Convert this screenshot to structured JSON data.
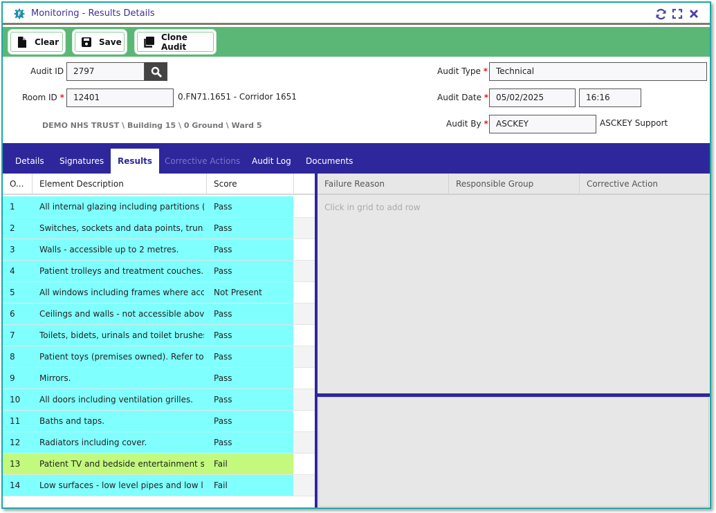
{
  "window": {
    "title": "Monitoring - Results Details",
    "app_icon": "gear-f-icon",
    "controls": [
      {
        "name": "refresh",
        "icon": "refresh-icon"
      },
      {
        "name": "maximize",
        "icon": "expand-icon"
      },
      {
        "name": "close",
        "icon": "close-icon"
      }
    ]
  },
  "toolbar": {
    "clear_label": "Clear",
    "save_label": "Save",
    "clone_label": "Clone Audit"
  },
  "form": {
    "audit_id": {
      "label": "Audit ID",
      "value": "2797"
    },
    "room_id": {
      "label": "Room ID",
      "required": "*",
      "value": "12401",
      "description": "0.FN71.1651 - Corridor 1651"
    },
    "location_path": "DEMO NHS TRUST \\ Building 15 \\ 0 Ground \\ Ward 5",
    "audit_type": {
      "label": "Audit Type",
      "required": "*",
      "value": "Technical"
    },
    "audit_date": {
      "label": "Audit Date",
      "required": "*",
      "date": "05/02/2025",
      "time": "16:16"
    },
    "audit_by": {
      "label": "Audit By",
      "required": "*",
      "value": "ASCKEY",
      "name": "ASCKEY Support"
    }
  },
  "tabs": [
    {
      "label": "Details",
      "state": "normal"
    },
    {
      "label": "Signatures",
      "state": "normal"
    },
    {
      "label": "Results",
      "state": "active"
    },
    {
      "label": "Corrective Actions",
      "state": "disabled"
    },
    {
      "label": "Audit Log",
      "state": "normal"
    },
    {
      "label": "Documents",
      "state": "normal"
    }
  ],
  "results_grid": {
    "columns": [
      "O...",
      "Element Description",
      "Score"
    ],
    "rows": [
      {
        "order": "1",
        "description": "All internal glazing including partitions (...",
        "score": "Pass"
      },
      {
        "order": "2",
        "description": "Switches, sockets and data points, trun...",
        "score": "Pass"
      },
      {
        "order": "3",
        "description": "Walls - accessible up to 2 metres.",
        "score": "Pass"
      },
      {
        "order": "4",
        "description": "Patient trolleys and treatment couches....",
        "score": "Pass"
      },
      {
        "order": "5",
        "description": "All windows including frames where acc...",
        "score": "Not Present"
      },
      {
        "order": "6",
        "description": "Ceilings and walls - not accessible abov...",
        "score": "Pass"
      },
      {
        "order": "7",
        "description": "Toilets, bidets, urinals and toilet brushes.",
        "score": "Pass"
      },
      {
        "order": "8",
        "description": "Patient toys (premises owned). Refer to ...",
        "score": "Pass"
      },
      {
        "order": "9",
        "description": "Mirrors.",
        "score": "Pass"
      },
      {
        "order": "10",
        "description": "All doors including ventilation grilles.",
        "score": "Pass"
      },
      {
        "order": "11",
        "description": "Baths and taps.",
        "score": "Pass"
      },
      {
        "order": "12",
        "description": "Radiators including cover.",
        "score": "Pass"
      },
      {
        "order": "13",
        "description": "Patient TV and bedside entertainment s...",
        "score": "Fail",
        "selected": true
      },
      {
        "order": "14",
        "description": "Low surfaces - low level pipes and low l...",
        "score": "Fail"
      }
    ]
  },
  "failure_grid": {
    "columns": [
      "Failure Reason",
      "Responsible Group",
      "Corrective Action"
    ],
    "placeholder": "Click in grid to add row"
  },
  "colors": {
    "accent": "#2d279b",
    "toolbar": "#5bb776",
    "row": "#80ffff",
    "row_selected": "#c3fa7d",
    "frame": "#1aa8a6"
  }
}
